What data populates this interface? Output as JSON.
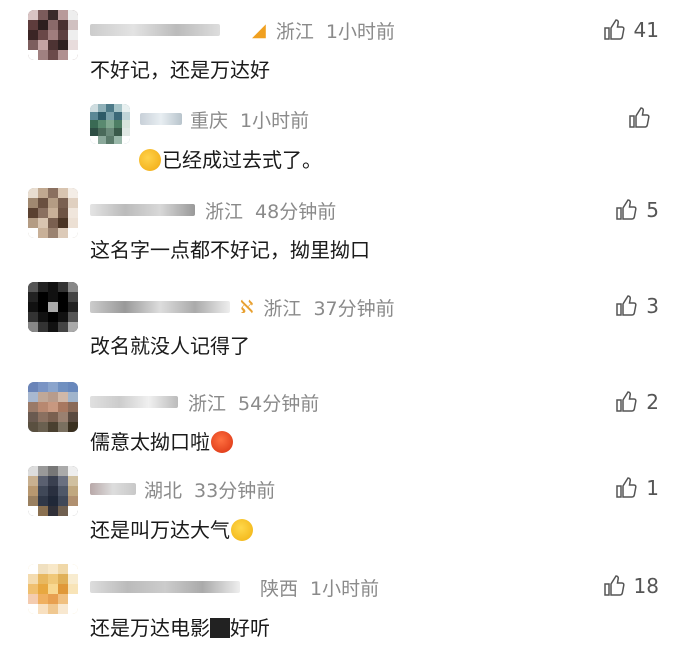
{
  "comments": [
    {
      "location": "浙江",
      "time": "1小时前",
      "text": "不好记，还是万达好",
      "likes": "41"
    },
    {
      "location": "重庆",
      "time": "1小时前",
      "text": "已经成过去式了。",
      "likes": ""
    },
    {
      "location": "浙江",
      "time": "48分钟前",
      "text": "这名字一点都不好记，拗里拗口",
      "likes": "5"
    },
    {
      "location": "浙江",
      "time": "37分钟前",
      "text": "改名就没人记得了",
      "likes": "3"
    },
    {
      "location": "浙江",
      "time": "54分钟前",
      "text": "儒意太拗口啦",
      "likes": "2"
    },
    {
      "location": "湖北",
      "time": "33分钟前",
      "text": "还是叫万达大气",
      "likes": "1"
    },
    {
      "location": "陕西",
      "time": "1小时前",
      "text_before": "还是万达电影",
      "text_after": "好听",
      "likes": "18"
    }
  ],
  "icons": {
    "like": "thumbs-up-icon"
  }
}
